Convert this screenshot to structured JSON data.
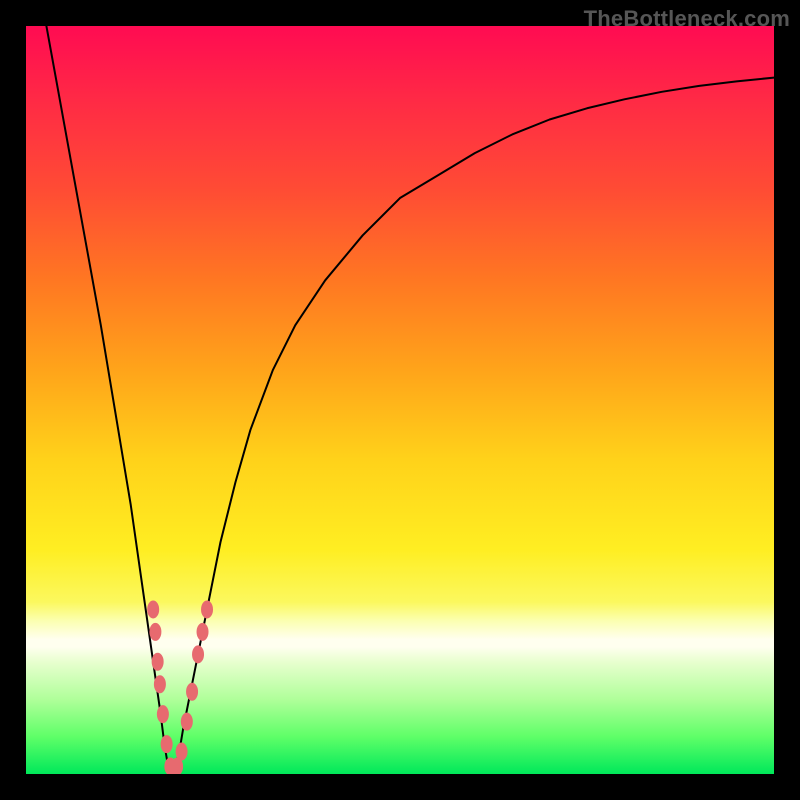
{
  "watermark": "TheBottleneck.com",
  "colors": {
    "curve_stroke": "#000000",
    "marker_fill": "#e76a6f",
    "marker_stroke": "#c84f55",
    "frame_bg": "#000000"
  },
  "chart_data": {
    "type": "line",
    "title": "",
    "xlabel": "",
    "ylabel": "",
    "xlim": [
      0,
      100
    ],
    "ylim": [
      0,
      100
    ],
    "x": [
      0,
      2,
      4,
      6,
      8,
      10,
      12,
      14,
      15,
      16,
      17,
      18,
      18.5,
      19,
      19.5,
      20,
      20.5,
      21,
      22,
      23,
      24,
      25,
      26,
      28,
      30,
      33,
      36,
      40,
      45,
      50,
      55,
      60,
      65,
      70,
      75,
      80,
      85,
      90,
      95,
      100
    ],
    "series": [
      {
        "name": "bottleneck-curve",
        "values": [
          115,
          104,
          93,
          82,
          71,
          60,
          48,
          36,
          29,
          22,
          15,
          8,
          4,
          1,
          0,
          1,
          3,
          6,
          11,
          16,
          21,
          26,
          31,
          39,
          46,
          54,
          60,
          66,
          72,
          77,
          80,
          83,
          85.5,
          87.5,
          89,
          90.2,
          91.2,
          92,
          92.6,
          93.1
        ]
      }
    ],
    "markers": {
      "name": "gpu-points",
      "points": [
        {
          "x": 17.0,
          "y": 22
        },
        {
          "x": 17.3,
          "y": 19
        },
        {
          "x": 17.6,
          "y": 15
        },
        {
          "x": 17.9,
          "y": 12
        },
        {
          "x": 18.3,
          "y": 8
        },
        {
          "x": 18.8,
          "y": 4
        },
        {
          "x": 19.3,
          "y": 1
        },
        {
          "x": 19.7,
          "y": 0
        },
        {
          "x": 20.2,
          "y": 1
        },
        {
          "x": 20.8,
          "y": 3
        },
        {
          "x": 21.5,
          "y": 7
        },
        {
          "x": 22.2,
          "y": 11
        },
        {
          "x": 23.0,
          "y": 16
        },
        {
          "x": 23.6,
          "y": 19
        },
        {
          "x": 24.2,
          "y": 22
        }
      ],
      "rx": 6,
      "ry": 9
    }
  }
}
